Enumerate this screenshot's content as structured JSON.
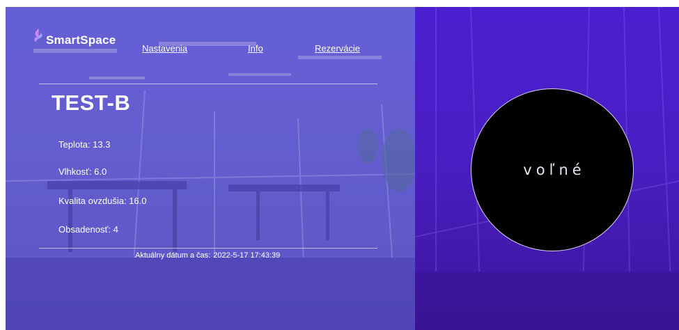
{
  "header": {
    "brand": "SmartSpace",
    "nav": [
      {
        "label": "Nastavenia"
      },
      {
        "label": "Info"
      },
      {
        "label": "Rezervácie"
      }
    ]
  },
  "room": {
    "name": "TEST-B",
    "metrics": [
      {
        "label": "Teplota",
        "value": "13.3",
        "text": "Teplota: 13.3"
      },
      {
        "label": "Vlhkosť",
        "value": "6.0",
        "text": "Vlhkosť: 6.0"
      },
      {
        "label": "Kvalita ovzdušia",
        "value": "16.0",
        "text": "Kvalita ovzdušia: 16.0"
      },
      {
        "label": "Obsadenosť",
        "value": "4",
        "text": "Obsadenosť: 4"
      }
    ],
    "datetime_label": "Aktuálny dátum a čas:",
    "datetime_value": "2022-5-17 17:43:39"
  },
  "status": {
    "text": "voľné"
  },
  "colors": {
    "left_overlay": "#5649d2",
    "right_panel": "#4b1fd0",
    "status_circle": "#000000",
    "text": "#ffffff"
  },
  "icons": {
    "logo": "smartspace-flame-icon"
  }
}
